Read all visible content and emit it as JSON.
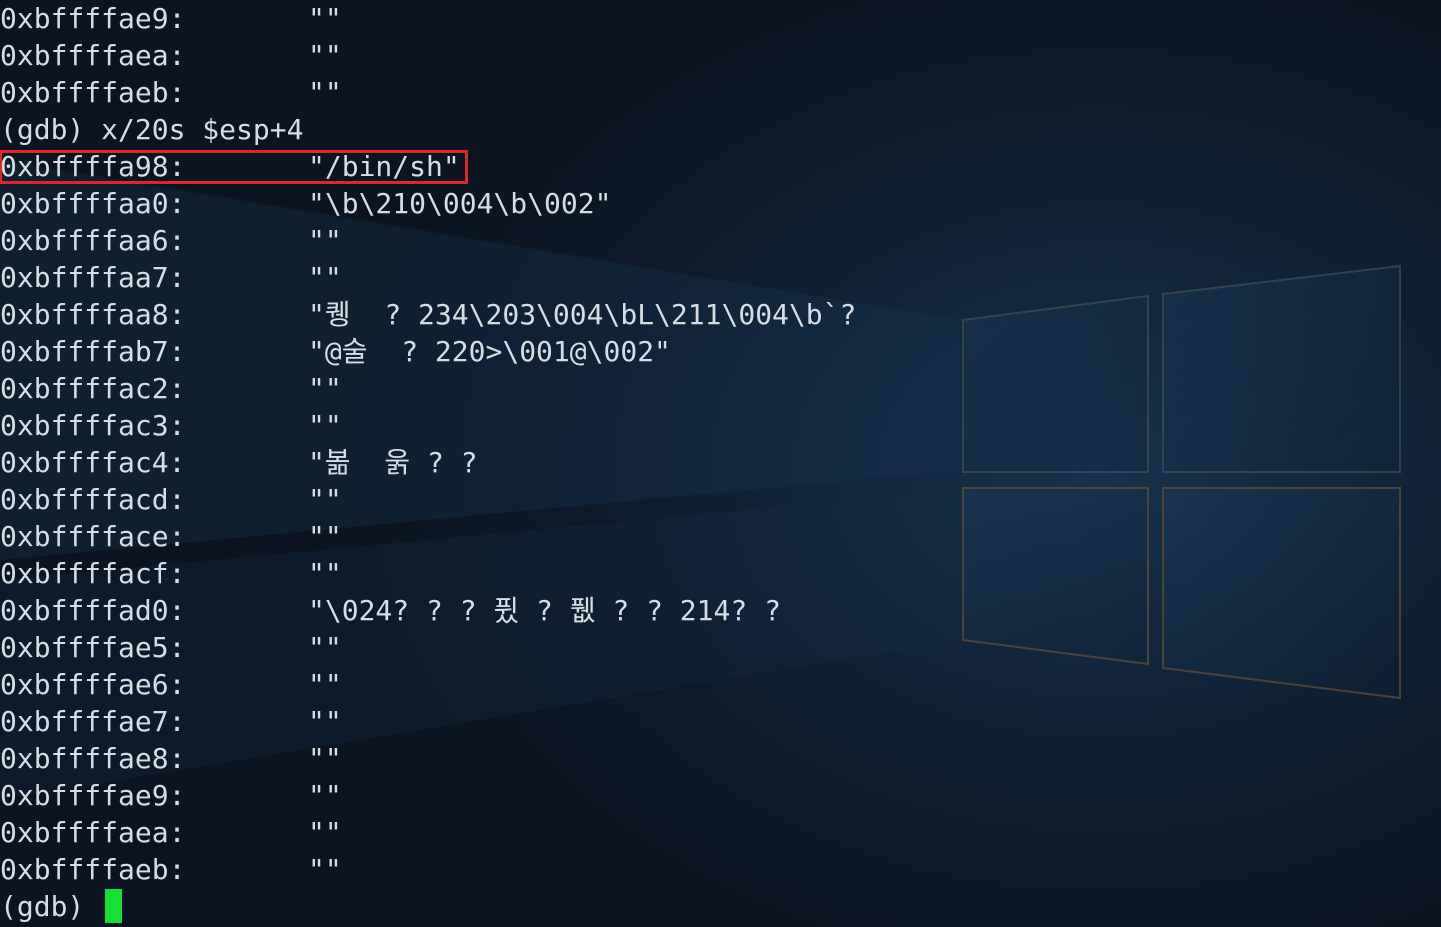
{
  "terminal": {
    "lines_top": [
      {
        "addr": "0xbffffae9:",
        "val": "\"\""
      },
      {
        "addr": "0xbffffaea:",
        "val": "\"\""
      },
      {
        "addr": "0xbffffaeb:",
        "val": "\"\""
      }
    ],
    "command": "(gdb) x/20s $esp+4",
    "highlighted": {
      "addr": "0xbffffa98:",
      "val": "\"/bin/sh\""
    },
    "lines": [
      {
        "addr": "0xbffffaa0:",
        "val": "\"\\b\\210\\004\\b\\002\""
      },
      {
        "addr": "0xbffffaa6:",
        "val": "\"\""
      },
      {
        "addr": "0xbffffaa7:",
        "val": "\"\""
      },
      {
        "addr": "0xbffffaa8:",
        "val": "\"퀭  ? 234\\203\\004\\bL\\211\\004\\b`?"
      },
      {
        "addr": "0xbffffab7:",
        "val": "\"@술  ? 220>\\001@\\002\""
      },
      {
        "addr": "0xbffffac2:",
        "val": "\"\""
      },
      {
        "addr": "0xbffffac3:",
        "val": "\"\""
      },
      {
        "addr": "0xbffffac4:",
        "val": "\"볾  욹 ? ?"
      },
      {
        "addr": "0xbffffacd:",
        "val": "\"\""
      },
      {
        "addr": "0xbfffface:",
        "val": "\"\""
      },
      {
        "addr": "0xbffffacf:",
        "val": "\"\""
      },
      {
        "addr": "0xbffffad0:",
        "val": "\"\\024? ? ? 퓠 ? 퓂 ? ? 214? ?"
      },
      {
        "addr": "0xbffffae5:",
        "val": "\"\""
      },
      {
        "addr": "0xbffffae6:",
        "val": "\"\""
      },
      {
        "addr": "0xbffffae7:",
        "val": "\"\""
      },
      {
        "addr": "0xbffffae8:",
        "val": "\"\""
      },
      {
        "addr": "0xbffffae9:",
        "val": "\"\""
      },
      {
        "addr": "0xbffffaea:",
        "val": "\"\""
      },
      {
        "addr": "0xbffffaeb:",
        "val": "\"\""
      }
    ],
    "prompt": "(gdb) ",
    "colors": {
      "text": "#d7dde4",
      "highlight_border": "#e02428",
      "cursor": "#16e032",
      "background": "#0c1521"
    }
  }
}
